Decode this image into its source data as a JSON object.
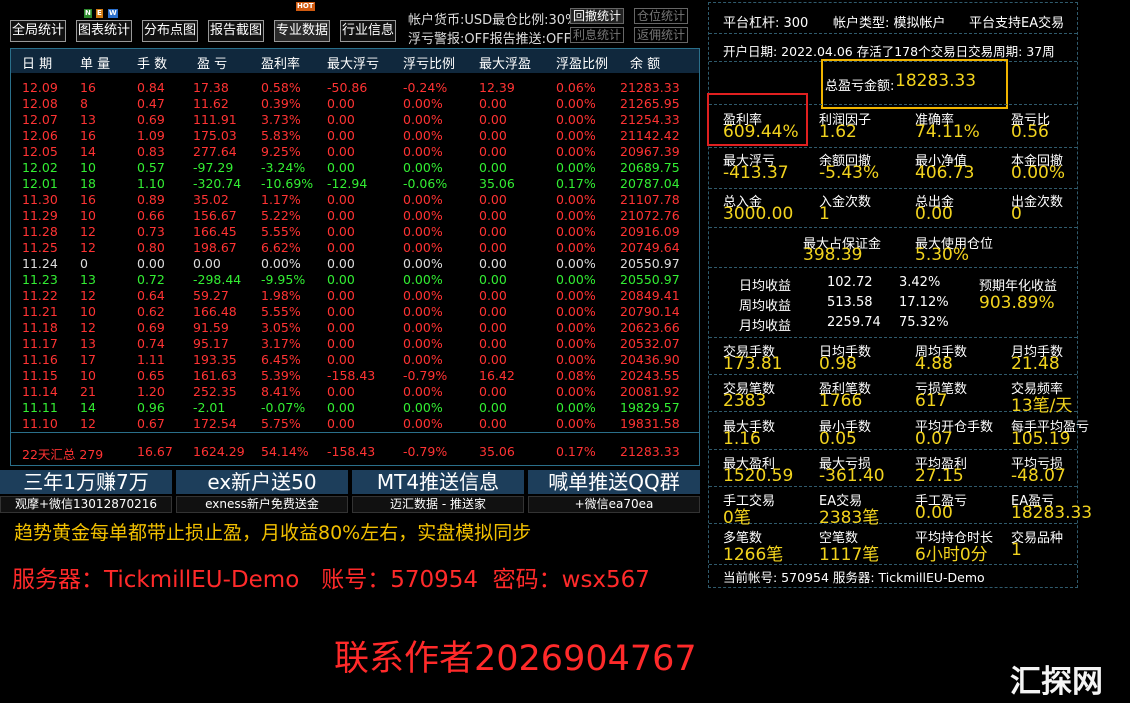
{
  "toolbar": {
    "buttons": [
      "全局统计",
      "图表统计",
      "分布点图",
      "报告截图",
      "专业数据",
      "行业信息"
    ],
    "badge_new": [
      "N",
      "E",
      "W"
    ],
    "badge_hot": "HOT"
  },
  "status": {
    "line1": "帐户货币:USD最仓比例:30%",
    "line2": "浮亏警报:OFF报告推送:OFF",
    "withdraw_stats": "回撤统计",
    "position_stats": "仓位统计",
    "interest_stats": "利息统计",
    "commission_stats": "返佣统计"
  },
  "table": {
    "headers": [
      "日 期",
      "单 量",
      "手 数",
      "盈 亏",
      "盈利率",
      "最大浮亏",
      "浮亏比例",
      "最大浮盈",
      "浮盈比例",
      "余 额"
    ],
    "rows": [
      {
        "c": "r",
        "cells": [
          "12.09",
          "16",
          "0.84",
          "17.38",
          "0.58%",
          "-50.86",
          "-0.24%",
          "12.39",
          "0.06%",
          "21283.33"
        ]
      },
      {
        "c": "r",
        "cells": [
          "12.08",
          "8",
          "0.47",
          "11.62",
          "0.39%",
          "0.00",
          "0.00%",
          "0.00",
          "0.00%",
          "21265.95"
        ]
      },
      {
        "c": "r",
        "cells": [
          "12.07",
          "13",
          "0.69",
          "111.91",
          "3.73%",
          "0.00",
          "0.00%",
          "0.00",
          "0.00%",
          "21254.33"
        ]
      },
      {
        "c": "r",
        "cells": [
          "12.06",
          "16",
          "1.09",
          "175.03",
          "5.83%",
          "0.00",
          "0.00%",
          "0.00",
          "0.00%",
          "21142.42"
        ]
      },
      {
        "c": "r",
        "cells": [
          "12.05",
          "14",
          "0.83",
          "277.64",
          "9.25%",
          "0.00",
          "0.00%",
          "0.00",
          "0.00%",
          "20967.39"
        ]
      },
      {
        "c": "g",
        "cells": [
          "12.02",
          "10",
          "0.57",
          "-97.29",
          "-3.24%",
          "0.00",
          "0.00%",
          "0.00",
          "0.00%",
          "20689.75"
        ]
      },
      {
        "c": "g",
        "cells": [
          "12.01",
          "18",
          "1.10",
          "-320.74",
          "-10.69%",
          "-12.94",
          "-0.06%",
          "35.06",
          "0.17%",
          "20787.04"
        ]
      },
      {
        "c": "r",
        "cells": [
          "11.30",
          "16",
          "0.89",
          "35.02",
          "1.17%",
          "0.00",
          "0.00%",
          "0.00",
          "0.00%",
          "21107.78"
        ]
      },
      {
        "c": "r",
        "cells": [
          "11.29",
          "10",
          "0.66",
          "156.67",
          "5.22%",
          "0.00",
          "0.00%",
          "0.00",
          "0.00%",
          "21072.76"
        ]
      },
      {
        "c": "r",
        "cells": [
          "11.28",
          "12",
          "0.73",
          "166.45",
          "5.55%",
          "0.00",
          "0.00%",
          "0.00",
          "0.00%",
          "20916.09"
        ]
      },
      {
        "c": "r",
        "cells": [
          "11.25",
          "12",
          "0.80",
          "198.67",
          "6.62%",
          "0.00",
          "0.00%",
          "0.00",
          "0.00%",
          "20749.64"
        ]
      },
      {
        "c": "w",
        "cells": [
          "11.24",
          "0",
          "0.00",
          "0.00",
          "0.00%",
          "0.00",
          "0.00%",
          "0.00",
          "0.00%",
          "20550.97"
        ]
      },
      {
        "c": "g",
        "cells": [
          "11.23",
          "13",
          "0.72",
          "-298.44",
          "-9.95%",
          "0.00",
          "0.00%",
          "0.00",
          "0.00%",
          "20550.97"
        ]
      },
      {
        "c": "r",
        "cells": [
          "11.22",
          "12",
          "0.64",
          "59.27",
          "1.98%",
          "0.00",
          "0.00%",
          "0.00",
          "0.00%",
          "20849.41"
        ]
      },
      {
        "c": "r",
        "cells": [
          "11.21",
          "10",
          "0.62",
          "166.48",
          "5.55%",
          "0.00",
          "0.00%",
          "0.00",
          "0.00%",
          "20790.14"
        ]
      },
      {
        "c": "r",
        "cells": [
          "11.18",
          "12",
          "0.69",
          "91.59",
          "3.05%",
          "0.00",
          "0.00%",
          "0.00",
          "0.00%",
          "20623.66"
        ]
      },
      {
        "c": "r",
        "cells": [
          "11.17",
          "13",
          "0.74",
          "95.17",
          "3.17%",
          "0.00",
          "0.00%",
          "0.00",
          "0.00%",
          "20532.07"
        ]
      },
      {
        "c": "r",
        "cells": [
          "11.16",
          "17",
          "1.11",
          "193.35",
          "6.45%",
          "0.00",
          "0.00%",
          "0.00",
          "0.00%",
          "20436.90"
        ]
      },
      {
        "c": "r",
        "cells": [
          "11.15",
          "10",
          "0.65",
          "161.63",
          "5.39%",
          "-158.43",
          "-0.79%",
          "16.42",
          "0.08%",
          "20243.55"
        ]
      },
      {
        "c": "r",
        "cells": [
          "11.14",
          "21",
          "1.20",
          "252.35",
          "8.41%",
          "0.00",
          "0.00%",
          "0.00",
          "0.00%",
          "20081.92"
        ]
      },
      {
        "c": "g",
        "cells": [
          "11.11",
          "14",
          "0.96",
          "-2.01",
          "-0.07%",
          "0.00",
          "0.00%",
          "0.00",
          "0.00%",
          "19829.57"
        ]
      },
      {
        "c": "r",
        "cells": [
          "11.10",
          "12",
          "0.67",
          "172.54",
          "5.75%",
          "0.00",
          "0.00%",
          "0.00",
          "0.00%",
          "19831.58"
        ]
      }
    ],
    "summary": [
      "22天汇总 279",
      "16.67",
      "1624.29",
      "54.14%",
      "-158.43",
      "-0.79%",
      "35.06",
      "0.17%",
      "21283.33"
    ]
  },
  "ads": [
    {
      "title": "三年1万赚7万",
      "sub": "观摩+微信13012870216"
    },
    {
      "title": "ex新户送50",
      "sub": "exness新户免费送金"
    },
    {
      "title": "MT4推送信息",
      "sub": "迈汇数据 - 推送家"
    },
    {
      "title": "喊单推送QQ群",
      "sub": "+微信ea70ea"
    }
  ],
  "promo": {
    "line1": "趋势黄金每单都带止损止盈，月收益80%左右，实盘模拟同步",
    "line2": "服务器：TickmillEU-Demo   账号：570954  密码：wsx567",
    "contact": "联系作者2026904767",
    "watermark": "汇探网"
  },
  "panel": {
    "leverage": "平台杠杆:  300",
    "account_type": "帐户类型:  模拟帐户",
    "ea_support": "平台支持EA交易",
    "open_info": "开户日期:  2022.04.06  存活了178个交易日交易周期:  37周",
    "total_label": "总盈亏金额:",
    "total_value": "18283.33",
    "g1": [
      {
        "label": "盈利率",
        "value": "609.44%"
      },
      {
        "label": "利润因子",
        "value": "1.62"
      },
      {
        "label": "准确率",
        "value": "74.11%"
      },
      {
        "label": "盈亏比",
        "value": "0.56"
      }
    ],
    "g2": [
      {
        "label": "最大浮亏",
        "value": "-413.37"
      },
      {
        "label": "余额回撤",
        "value": "-5.43%"
      },
      {
        "label": "最小净值",
        "value": "406.73"
      },
      {
        "label": "本金回撤",
        "value": "0.00%"
      }
    ],
    "g3": [
      {
        "label": "总入金",
        "value": "3000.00"
      },
      {
        "label": "入金次数",
        "value": "1"
      },
      {
        "label": "总出金",
        "value": "0.00"
      },
      {
        "label": "出金次数",
        "value": "0"
      }
    ],
    "g4": [
      {
        "label": "最大占保证金",
        "value": "398.39"
      },
      {
        "label": "最大使用仓位",
        "value": "5.30%"
      }
    ],
    "returns": [
      {
        "label": "日均收益",
        "amount": "102.72",
        "pct": "3.42%"
      },
      {
        "label": "周均收益",
        "amount": "513.58",
        "pct": "17.12%"
      },
      {
        "label": "月均收益",
        "amount": "2259.74",
        "pct": "75.32%"
      }
    ],
    "annual_label": "预期年化收益",
    "annual_value": "903.89%",
    "g5": [
      {
        "label": "交易手数",
        "value": "173.81"
      },
      {
        "label": "日均手数",
        "value": "0.98"
      },
      {
        "label": "周均手数",
        "value": "4.88"
      },
      {
        "label": "月均手数",
        "value": "21.48"
      }
    ],
    "g6": [
      {
        "label": "交易笔数",
        "value": "2383"
      },
      {
        "label": "盈利笔数",
        "value": "1766"
      },
      {
        "label": "亏损笔数",
        "value": "617"
      },
      {
        "label": "交易频率",
        "value": "13笔/天"
      }
    ],
    "g7": [
      {
        "label": "最大手数",
        "value": "1.16"
      },
      {
        "label": "最小手数",
        "value": "0.05"
      },
      {
        "label": "平均开仓手数",
        "value": "0.07"
      },
      {
        "label": "每手平均盈亏",
        "value": "105.19"
      }
    ],
    "g8": [
      {
        "label": "最大盈利",
        "value": "1520.59"
      },
      {
        "label": "最大亏损",
        "value": "-361.40"
      },
      {
        "label": "平均盈利",
        "value": "27.15"
      },
      {
        "label": "平均亏损",
        "value": "-48.07"
      }
    ],
    "g9": [
      {
        "label": "手工交易",
        "value": "0笔"
      },
      {
        "label": "EA交易",
        "value": "2383笔"
      },
      {
        "label": "手工盈亏",
        "value": "0.00"
      },
      {
        "label": "EA盈亏",
        "value": "18283.33"
      }
    ],
    "g10": [
      {
        "label": "多笔数",
        "value": "1266笔"
      },
      {
        "label": "空笔数",
        "value": "1117笔"
      },
      {
        "label": "平均持仓时长",
        "value": "6小时0分"
      },
      {
        "label": "交易品种",
        "value": "1"
      }
    ],
    "footer": "当前帐号:  570954   服务器:  TickmillEU-Demo"
  },
  "colors": {
    "profit": "#ff3333",
    "loss": "#33ee33",
    "highlight": "#f2d31e",
    "header_bg": "#10283d",
    "ad_bg": "#1d3e5b"
  }
}
